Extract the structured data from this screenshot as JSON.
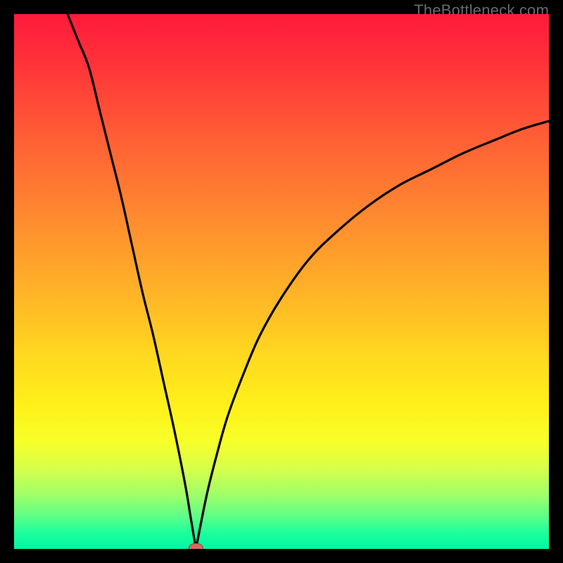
{
  "watermark": "TheBottleneck.com",
  "colors": {
    "page_bg": "#000000",
    "curve": "#000000",
    "marker_fill": "#d46a5e",
    "marker_stroke": "#a04438"
  },
  "chart_data": {
    "type": "line",
    "title": "",
    "xlabel": "",
    "ylabel": "",
    "xlim": [
      0,
      100
    ],
    "ylim": [
      0,
      100
    ],
    "grid": false,
    "legend": false,
    "description": "V-shaped bottleneck curve with a sharp minimum near x≈34. Left branch is nearly vertical from the top; right branch rises with decreasing slope toward the top-right.",
    "minimum": {
      "x": 34,
      "y": 0
    },
    "series": [
      {
        "name": "left_branch",
        "x": [
          10,
          12,
          14,
          16,
          18,
          20,
          22,
          24,
          26,
          28,
          30,
          32,
          33,
          34
        ],
        "y": [
          100,
          95,
          90,
          82,
          74,
          66,
          57,
          48,
          40,
          31,
          22,
          12,
          6,
          0
        ]
      },
      {
        "name": "right_branch",
        "x": [
          34,
          36,
          38,
          40,
          43,
          46,
          50,
          55,
          60,
          66,
          72,
          78,
          84,
          90,
          95,
          100
        ],
        "y": [
          0,
          10,
          18,
          25,
          33,
          40,
          47,
          54,
          59,
          64,
          68,
          71,
          74,
          76.5,
          78.5,
          80
        ]
      }
    ],
    "marker": {
      "x": 34,
      "y": 0,
      "rx": 10,
      "ry": 6
    }
  }
}
